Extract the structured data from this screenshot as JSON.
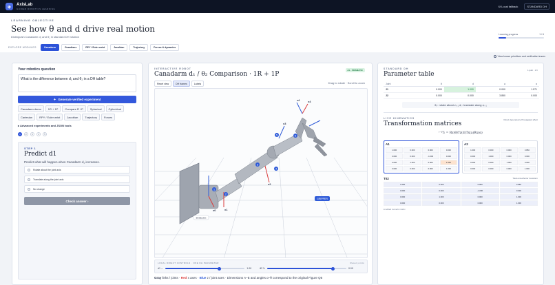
{
  "app": {
    "name": "AxisLab",
    "tagline": "GUIDED ROBOTICS LEARNING",
    "local_fallback": "Local fallback",
    "model": "STANDARD DH"
  },
  "header": {
    "eyebrow": "LEARNING OBJECTIVE",
    "title": "See how θ and d drive real motion",
    "subtitle": "Distinguish Canadarm d₁ and θ₂ in standard DH rotation",
    "progress_label": "Learning progress",
    "progress_value": "1 / 6",
    "progress_fraction": 0.17,
    "modules_label": "EXPLORE MODULES",
    "modules": [
      "Canadarm",
      "Guardians",
      "RPY / Euler wrist",
      "Jacobian",
      "Trajectory",
      "Forces & dynamics"
    ],
    "active_module": 0,
    "view_link": "View known primitives and verification traces"
  },
  "left": {
    "title": "Your robotics question",
    "question": "What is the difference between d₁ and θ₂ in a DH table?",
    "generate_label": "Generate verified experiment",
    "chips": [
      "Canadarm demo",
      "1R + 1P",
      "Compare R / P",
      "Spherical",
      "Cylindrical",
      "Cartesian",
      "RPY / Euler wrist",
      "Jacobian",
      "Trajectory",
      "Forces"
    ],
    "advanced_label": "Advanced experiments and JSON tools",
    "steps": [
      "1",
      "2",
      "3",
      "4",
      "5"
    ],
    "step_label": "STEP 1",
    "step_title": "Predict d1",
    "step_question": "Predict what will happen when Canadarm d₁ increases.",
    "options": [
      "Rotate about the joint axis",
      "Translate along the joint axis",
      "No change"
    ],
    "check_label": "Check answer"
  },
  "middle": {
    "eyebrow": "INTERACTIVE ROBOT",
    "title": "Canadarm d₁ / θ₂ Comparison · 1R + 1P",
    "badge": "d1 · PRISMATIC",
    "toolbar": [
      "Reset view",
      "DH frames",
      "Labels"
    ],
    "hint": "Drag to rotate · Scroll to zoom",
    "scene_labels": {
      "gripper": "GRIPPER",
      "base": "BASE/LEG",
      "frames": [
        "x0",
        "x1",
        "x2",
        "x3",
        "x4",
        "z4"
      ],
      "markers": [
        "1",
        "2",
        "3",
        "4",
        "5",
        "6"
      ]
    },
    "sliders_title": "LOCAL DIRECT CONTROLS · ONE DH PARAMETER",
    "sliders_reset": "Reset joints",
    "slider1_label": "d1 ↔",
    "slider1_value": "1.00",
    "slider1_fraction": 0.68,
    "slider2_label": "θ2 ↻",
    "slider2_value": "0.00",
    "slider2_fraction": 0.83,
    "legend": {
      "gray": "Gray",
      "gray_desc": "links / joints",
      "red": "Red",
      "red_desc": "x axes",
      "blue": "Blue",
      "blue_desc": "z / joint axes",
      "rest": "Dimensions A–E and angles α–θ correspond to the original Figure Q5"
    }
  },
  "right": {
    "dh_eyebrow": "STANDARD DH",
    "dh_title": "Parameter table",
    "dh_note": "1 joint · 1 fr",
    "dh_headers": [
      "Joint",
      "θ",
      "d",
      "a",
      "α"
    ],
    "dh_rows": [
      [
        "J1",
        "0.000",
        "1.000",
        "0.000",
        "1.571"
      ],
      [
        "J2",
        "0.000",
        "0.000",
        "3.850",
        "0.000"
      ]
    ],
    "dh_formula": "θᵢ : rotate about zᵢ₋₁    dᵢ : translate along zᵢ₋₁",
    "fk_eyebrow": "LIVE KINEMATICS",
    "fk_title": "Transformation matrices",
    "fk_note": "Direct dependency  Propagated effect",
    "fk_eq": "ⁱ⁻¹Tᵢ = Rz(θ)Tz(d)Tx(a)Rx(α)",
    "A1_name": "A1",
    "A1": [
      "1.000",
      "0.000",
      "0.000",
      "0.000",
      "0.000",
      "0.000",
      "-1.000",
      "0.000",
      "0.000",
      "1.000",
      "0.000",
      "1.000",
      "0.000",
      "0.000",
      "0.000",
      "1.000"
    ],
    "A2_name": "A2",
    "A2": [
      "1.000",
      "0.000",
      "0.000",
      "3.850",
      "0.000",
      "1.000",
      "0.000",
      "0.000",
      "0.000",
      "0.000",
      "1.000",
      "0.000",
      "0.000",
      "0.000",
      "0.000",
      "1.000"
    ],
    "T02_name": "T02",
    "T02_note": "Total end-effector transform",
    "T02": [
      "1.000",
      "0.000",
      "0.000",
      "3.850",
      "0.000",
      "0.000",
      "-1.000",
      "0.000",
      "0.000",
      "1.000",
      "0.000",
      "1.000",
      "0.000",
      "0.000",
      "0.000",
      "1.000"
    ],
    "footnote": "● Added numeric matrix"
  },
  "colors": {
    "accent": "#2c52d8",
    "dark": "#0d1424",
    "highlight": "#1f7a43",
    "x_axis": "#d93a3a",
    "z_axis": "#2f5bd8"
  }
}
